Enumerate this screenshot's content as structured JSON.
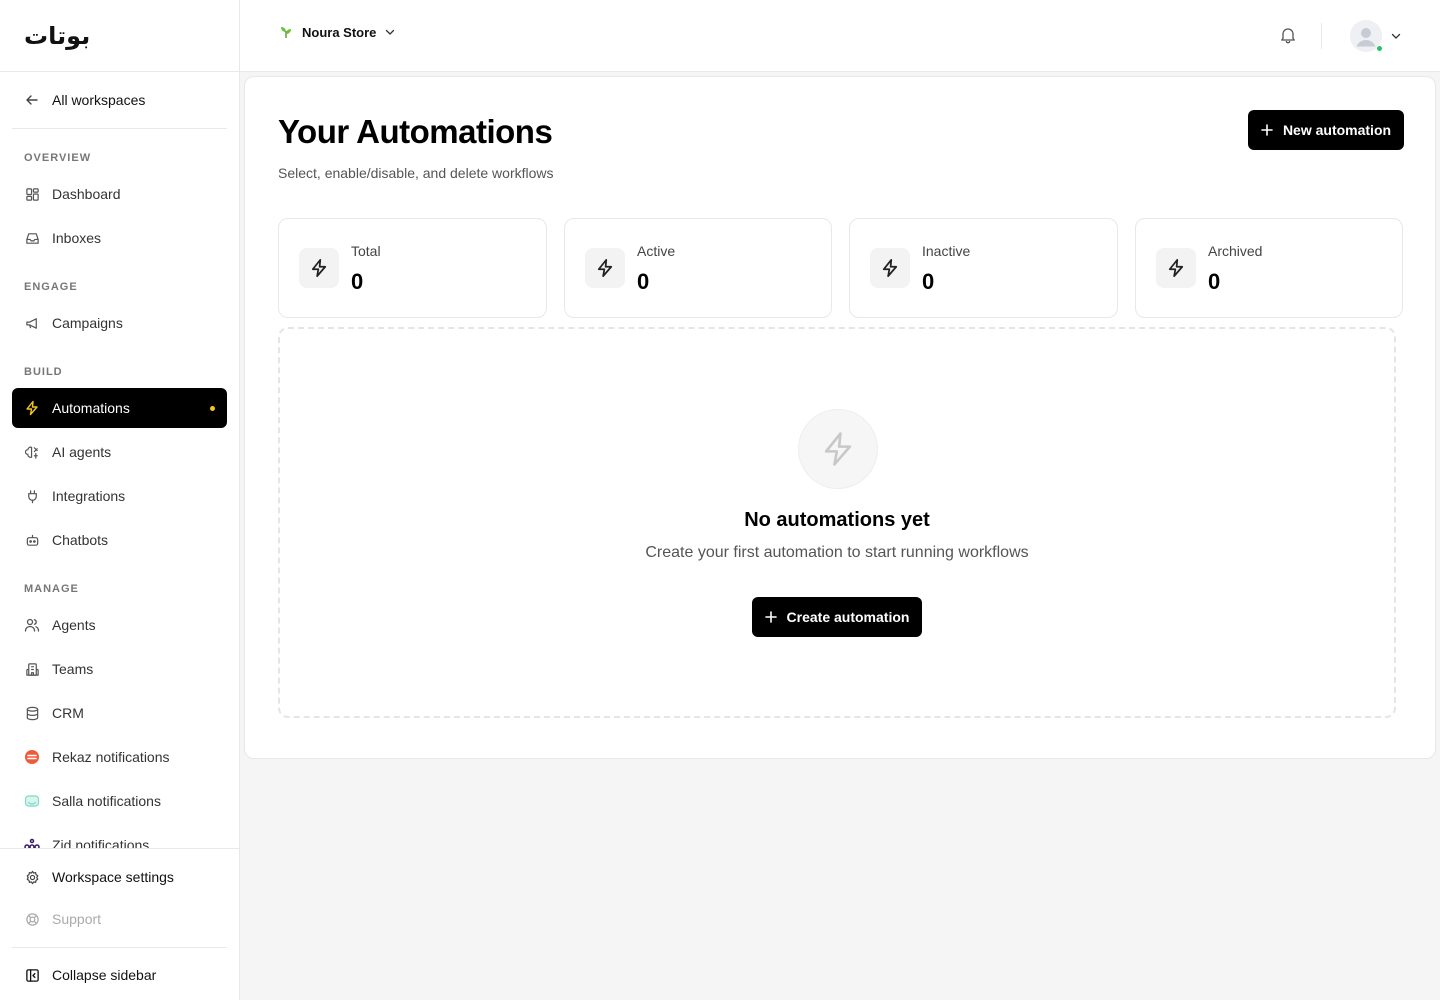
{
  "brand": {
    "logo_text": "بوتات"
  },
  "sidebar": {
    "back_label": "All workspaces",
    "sections": {
      "overview": "OVERVIEW",
      "engage": "ENGAGE",
      "build": "BUILD",
      "manage": "MANAGE"
    },
    "items": {
      "dashboard": "Dashboard",
      "inboxes": "Inboxes",
      "campaigns": "Campaigns",
      "automations": "Automations",
      "ai_agents": "AI agents",
      "integrations": "Integrations",
      "chatbots": "Chatbots",
      "agents": "Agents",
      "teams": "Teams",
      "crm": "CRM",
      "rekaz": "Rekaz notifications",
      "salla": "Salla notifications",
      "zid": "Zid notifications"
    },
    "bottom": {
      "workspace_settings": "Workspace settings",
      "support": "Support",
      "collapse": "Collapse sidebar"
    },
    "active_item": "automations"
  },
  "header": {
    "store_name": "Noura Store"
  },
  "page": {
    "title": "Your Automations",
    "subtitle": "Select, enable/disable, and delete workflows",
    "new_button": "New automation"
  },
  "stats": [
    {
      "label": "Total",
      "value": "0"
    },
    {
      "label": "Active",
      "value": "0"
    },
    {
      "label": "Inactive",
      "value": "0"
    },
    {
      "label": "Archived",
      "value": "0"
    }
  ],
  "empty_state": {
    "title": "No automations yet",
    "subtitle": "Create your first automation to start running workflows",
    "button": "Create automation"
  },
  "colors": {
    "accent": "#f5c518",
    "primary": "#000000",
    "online": "#22c55e",
    "rekaz": "#ef5b3a",
    "salla": "#7fd8c4",
    "zid": "#3b1a6e"
  }
}
